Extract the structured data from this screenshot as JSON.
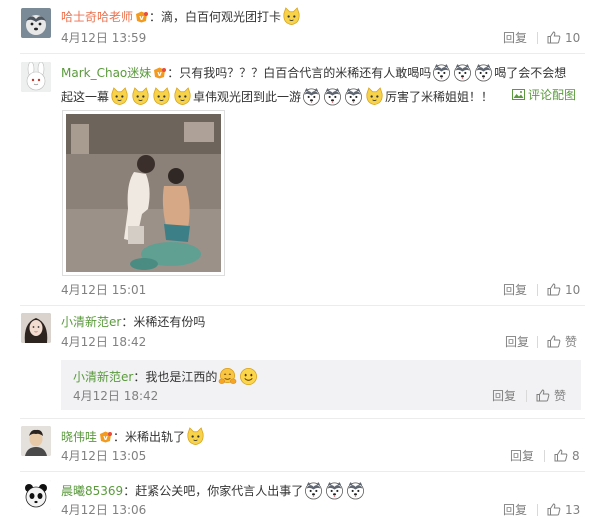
{
  "comments": [
    {
      "user": "哈士奇哈老师",
      "text_a": "：滴，白百何观光团打卡",
      "time": "4月12日 13:59",
      "reply_label": "回复",
      "like_count": "10"
    },
    {
      "user": "Mark_Chao迷妹",
      "text_a": "：只有我吗？？？白百合代言的米稀还有人敢喝吗",
      "text_b": "喝了会不会想",
      "text_c": "起这一幕",
      "text_d": "卓伟观光团到此一游",
      "text_e": "厉害了米稀姐姐！！",
      "pic_label": "评论配图",
      "time": "4月12日 15:01",
      "reply_label": "回复",
      "like_count": "10"
    },
    {
      "user": "小清新范er",
      "text_a": "：米稀还有份吗",
      "time": "4月12日 18:42",
      "reply_label": "回复",
      "like_label": "赞",
      "reply": {
        "user": "小清新范er",
        "text_a": "：我也是江西的",
        "time": "4月12日 18:42",
        "reply_label": "回复",
        "like_label": "赞"
      }
    },
    {
      "user": "晓伟哇",
      "text_a": "：米稀出轨了",
      "time": "4月12日 13:05",
      "reply_label": "回复",
      "like_count": "8"
    },
    {
      "user": "晨曦85369",
      "text_a": "：赶紧公关吧，你家代言人出事了",
      "time": "4月12日 13:06",
      "reply_label": "回复",
      "like_count": "13"
    }
  ],
  "colors": {
    "username_orange": "#eb7350",
    "username_green": "#5a9a3c",
    "meta_gray": "#808080",
    "reply_bg": "#f2f2f5"
  },
  "icons": [
    "vip-badge-icon",
    "cat-face-emoji-icon",
    "husky-face-emoji-icon",
    "hug-emoji-icon",
    "smile-emoji-icon",
    "thumbs-up-icon",
    "picture-icon"
  ]
}
